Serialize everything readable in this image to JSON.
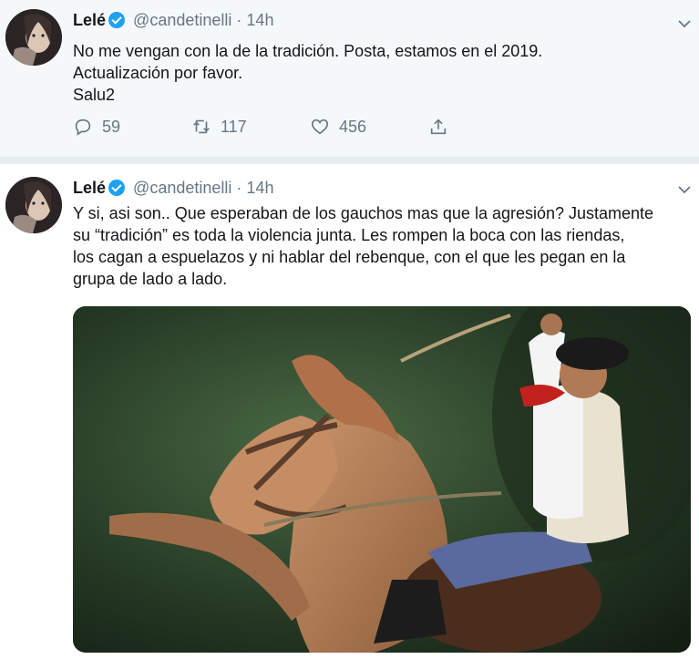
{
  "tweets": [
    {
      "name": "Lelé",
      "handle": "@candetinelli",
      "separator": "·",
      "time": "14h",
      "lines": [
        "No me vengan con la de la tradición. Posta, estamos en el 2019.",
        "Actualización por favor.",
        "Salu2"
      ],
      "replies": "59",
      "retweets": "117",
      "likes": "456"
    },
    {
      "name": "Lelé",
      "handle": "@candetinelli",
      "separator": "·",
      "time": "14h",
      "lines": [
        "Y si, asi son.. Que esperaban de los gauchos mas que la agresión? Justamente",
        "su “tradición” es toda la violencia junta. Les rompen la boca con las riendas,",
        "los cagan a espuelazos y ni hablar del rebenque, con el que les pegan en la",
        "grupa de lado a lado."
      ]
    }
  ],
  "icons": {
    "reply": "reply-icon",
    "retweet": "retweet-icon",
    "like": "heart-icon",
    "share": "share-icon",
    "more": "chevron-down-icon",
    "verified": "verified-badge-icon"
  },
  "colors": {
    "accent": "#1da1f2",
    "muted": "#657786",
    "text": "#14171a"
  }
}
